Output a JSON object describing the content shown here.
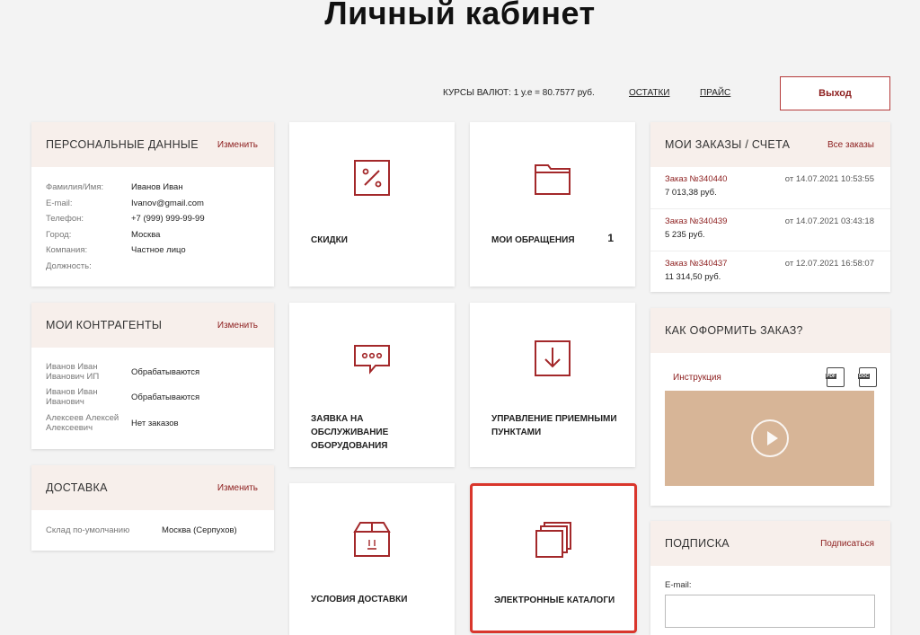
{
  "page_title": "Личный кабинет",
  "topbar": {
    "rates": "КУРСЫ ВАЛЮТ: 1 у.е = 80.7577 руб.",
    "stock_link": "ОСТАТКИ",
    "price_link": "ПРАЙС",
    "exit_button": "Выход"
  },
  "personal": {
    "title": "ПЕРСОНАЛЬНЫЕ ДАННЫЕ",
    "edit": "Изменить",
    "rows": [
      {
        "k": "Фамилия/Имя:",
        "v": "Иванов Иван"
      },
      {
        "k": "E-mail:",
        "v": "Ivanov@gmail.com"
      },
      {
        "k": "Телефон:",
        "v": "+7 (999) 999-99-99"
      },
      {
        "k": "Город:",
        "v": "Москва"
      },
      {
        "k": "Компания:",
        "v": "Частное лицо"
      },
      {
        "k": "Должность:",
        "v": ""
      }
    ]
  },
  "contractors": {
    "title": "МОИ КОНТРАГЕНТЫ",
    "edit": "Изменить",
    "rows": [
      {
        "k": "Иванов Иван Иванович ИП",
        "v": "Обрабатываются"
      },
      {
        "k": "Иванов Иван Иванович",
        "v": "Обрабатываются"
      },
      {
        "k": "Алексеев Алексей Алексеевич",
        "v": "Нет заказов"
      }
    ]
  },
  "delivery": {
    "title": "ДОСТАВКА",
    "edit": "Изменить",
    "k": "Склад по-умолчанию",
    "v": "Москва (Серпухов)"
  },
  "tiles": {
    "discounts": "СКИДКИ",
    "appeals": "МОИ ОБРАЩЕНИЯ",
    "appeals_count": "1",
    "service_request": "ЗАЯВКА НА ОБСЛУЖИВАНИЕ ОБОРУДОВАНИЯ",
    "pickup_points": "УПРАВЛЕНИЕ ПРИЕМНЫМИ ПУНКТАМИ",
    "delivery_terms": "УСЛОВИЯ ДОСТАВКИ",
    "catalogs": "ЭЛЕКТРОННЫЕ КАТАЛОГИ"
  },
  "orders": {
    "title": "МОИ ЗАКАЗЫ / СЧЕТА",
    "all": "Все заказы",
    "items": [
      {
        "num": "Заказ №340440",
        "date": "от 14.07.2021 10:53:55",
        "sum": "7 013,38 руб."
      },
      {
        "num": "Заказ №340439",
        "date": "от 14.07.2021 03:43:18",
        "sum": "5 235 руб."
      },
      {
        "num": "Заказ №340437",
        "date": "от 12.07.2021 16:58:07",
        "sum": "11 314,50 руб."
      }
    ]
  },
  "howto": {
    "title": "КАК ОФОРМИТЬ ЗАКАЗ?",
    "instruction": "Инструкция",
    "pdf_label": "PDF",
    "doc_label": "DOC"
  },
  "subscribe": {
    "title": "ПОДПИСКА",
    "action": "Подписаться",
    "email_label": "E-mail:",
    "email_value": ""
  },
  "colors": {
    "accent": "#8c1d1d",
    "header_bg": "#f7efeb",
    "video_bg": "#d7b597",
    "selection": "#d9362c"
  }
}
